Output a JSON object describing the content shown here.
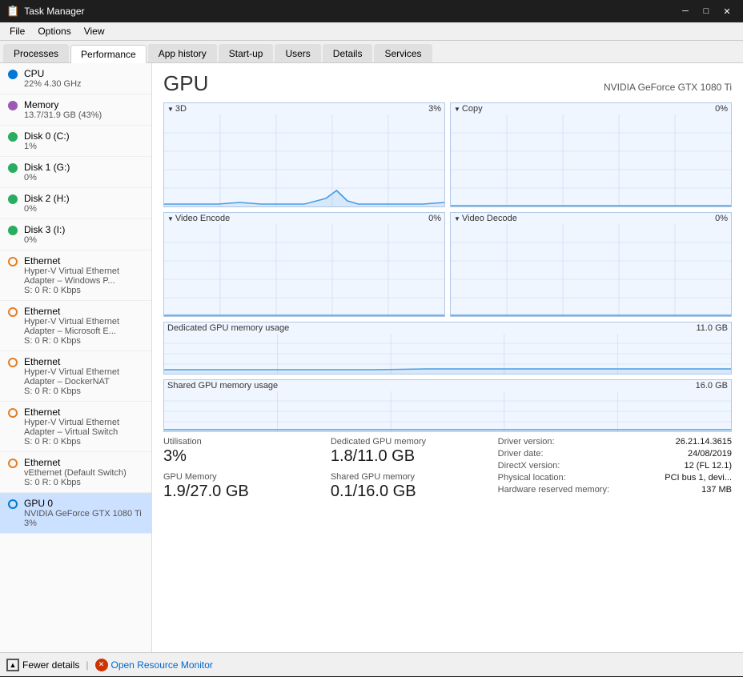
{
  "titleBar": {
    "icon": "📋",
    "title": "Task Manager",
    "minimizeLabel": "─",
    "maximizeLabel": "□",
    "closeLabel": "✕"
  },
  "menuBar": {
    "items": [
      "File",
      "Options",
      "View"
    ]
  },
  "tabs": [
    {
      "id": "processes",
      "label": "Processes"
    },
    {
      "id": "performance",
      "label": "Performance"
    },
    {
      "id": "app-history",
      "label": "App history"
    },
    {
      "id": "startup",
      "label": "Start-up"
    },
    {
      "id": "users",
      "label": "Users"
    },
    {
      "id": "details",
      "label": "Details"
    },
    {
      "id": "services",
      "label": "Services"
    }
  ],
  "sidebar": {
    "items": [
      {
        "id": "cpu",
        "name": "CPU",
        "sub1": "22% 4.30 GHz",
        "sub2": "",
        "dotColor": "#0078d4",
        "dotBorder": "#0078d4"
      },
      {
        "id": "memory",
        "name": "Memory",
        "sub1": "13.7/31.9 GB (43%)",
        "sub2": "",
        "dotColor": "#9b59b6",
        "dotBorder": "#9b59b6"
      },
      {
        "id": "disk0",
        "name": "Disk 0 (C:)",
        "sub1": "1%",
        "sub2": "",
        "dotColor": "#27ae60",
        "dotBorder": "#27ae60"
      },
      {
        "id": "disk1",
        "name": "Disk 1 (G:)",
        "sub1": "0%",
        "sub2": "",
        "dotColor": "#27ae60",
        "dotBorder": "#27ae60"
      },
      {
        "id": "disk2",
        "name": "Disk 2 (H:)",
        "sub1": "0%",
        "sub2": "",
        "dotColor": "#27ae60",
        "dotBorder": "#27ae60"
      },
      {
        "id": "disk3",
        "name": "Disk 3 (I:)",
        "sub1": "0%",
        "sub2": "",
        "dotColor": "#27ae60",
        "dotBorder": "#27ae60"
      },
      {
        "id": "eth1",
        "name": "Ethernet",
        "sub1": "Hyper-V Virtual Ethernet Adapter – Windows P...",
        "sub2": "S: 0 R: 0 Kbps",
        "dotColor": "transparent",
        "dotBorder": "#e67e22"
      },
      {
        "id": "eth2",
        "name": "Ethernet",
        "sub1": "Hyper-V Virtual Ethernet Adapter – Microsoft E...",
        "sub2": "S: 0 R: 0 Kbps",
        "dotColor": "transparent",
        "dotBorder": "#e67e22"
      },
      {
        "id": "eth3",
        "name": "Ethernet",
        "sub1": "Hyper-V Virtual Ethernet Adapter – DockerNAT",
        "sub2": "S: 0 R: 0 Kbps",
        "dotColor": "transparent",
        "dotBorder": "#e67e22"
      },
      {
        "id": "eth4",
        "name": "Ethernet",
        "sub1": "Hyper-V Virtual Ethernet Adapter – Virtual Switch",
        "sub2": "S: 0 R: 0 Kbps",
        "dotColor": "transparent",
        "dotBorder": "#e67e22"
      },
      {
        "id": "eth5",
        "name": "Ethernet",
        "sub1": "vEthernet (Default Switch)",
        "sub2": "S: 0 R: 0 Kbps",
        "dotColor": "transparent",
        "dotBorder": "#e67e22"
      },
      {
        "id": "gpu0",
        "name": "GPU 0",
        "sub1": "NVIDIA GeForce GTX 1080 Ti",
        "sub2": "3%",
        "dotColor": "transparent",
        "dotBorder": "#0078d4",
        "selected": true
      }
    ]
  },
  "rightPanel": {
    "title": "GPU",
    "model": "NVIDIA GeForce GTX 1080 Ti",
    "graphs": [
      {
        "id": "3d",
        "label": "3D",
        "pct": "3%",
        "hasData": true
      },
      {
        "id": "copy",
        "label": "Copy",
        "pct": "0%",
        "hasData": false
      },
      {
        "id": "video-encode",
        "label": "Video Encode",
        "pct": "0%",
        "hasData": false
      },
      {
        "id": "video-decode",
        "label": "Video Decode",
        "pct": "0%",
        "hasData": false
      }
    ],
    "memGraphs": [
      {
        "id": "dedicated-gpu-mem",
        "label": "Dedicated GPU memory usage",
        "maxLabel": "11.0 GB",
        "hasData": true
      },
      {
        "id": "shared-gpu-mem",
        "label": "Shared GPU memory usage",
        "maxLabel": "16.0 GB",
        "hasData": false
      }
    ],
    "stats": [
      {
        "id": "utilisation",
        "label": "Utilisation",
        "value": "3%"
      },
      {
        "id": "gpu-memory",
        "label": "GPU Memory",
        "value": "1.9/27.0 GB"
      }
    ],
    "stats2": [
      {
        "id": "dedicated-mem",
        "label": "Dedicated GPU memory",
        "value": "1.8/11.0 GB"
      },
      {
        "id": "shared-mem",
        "label": "Shared GPU memory",
        "value": "0.1/16.0 GB"
      }
    ],
    "info": [
      {
        "key": "Driver version:",
        "value": "26.21.14.3615"
      },
      {
        "key": "Driver date:",
        "value": "24/08/2019"
      },
      {
        "key": "DirectX version:",
        "value": "12 (FL 12.1)"
      },
      {
        "key": "Physical location:",
        "value": "PCI bus 1, devi..."
      },
      {
        "key": "Hardware reserved memory:",
        "value": "137 MB"
      }
    ]
  },
  "bottomBar": {
    "fewerDetails": "Fewer details",
    "openResourceMonitor": "Open Resource Monitor"
  }
}
